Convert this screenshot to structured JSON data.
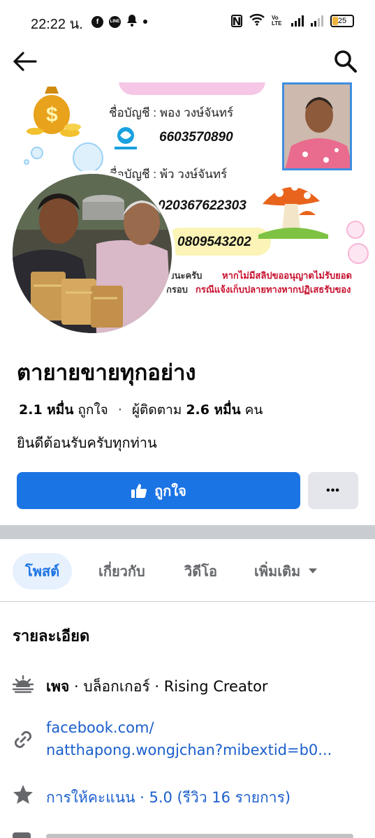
{
  "status_bar": {
    "time": "22:22 น.",
    "battery": "25",
    "volte": "Vo LTE"
  },
  "app_bar": {
    "back_icon": "arrow-left-icon",
    "search_icon": "search-icon"
  },
  "cover": {
    "account1_label": "ชื่อบัญชี : พอง  วงษ์จันทร์",
    "account1_number": "6603570890",
    "account2_label": "ชื่อบัญชี : พ้ว  วงษ์จันทร์",
    "account2_number": "020367622303",
    "phone": "0809543202",
    "note_left1": "ยนะครับ",
    "note_red1": "หากไม่มีสลิปขออนุญาตไม่รับยอด",
    "note_left2": "กรอบ",
    "note_red2": "กรณีแจ้งเก็บปลายทางหากปฏิเสธรับของ"
  },
  "page": {
    "name": "ตายายขายทุกอย่าง",
    "likes_count": "2.1 หมื่น",
    "likes_label": "ถูกใจ",
    "followers_label": "ผู้ติดตาม",
    "followers_count": "2.6 หมื่น",
    "followers_unit": "คน",
    "tagline": "ยินดีต้อนรับครับทุกท่าน"
  },
  "actions": {
    "like_label": "ถูกใจ",
    "more_label": "•••"
  },
  "tabs": [
    {
      "label": "โพสต์",
      "active": true
    },
    {
      "label": "เกี่ยวกับ",
      "active": false
    },
    {
      "label": "วิดีโอ",
      "active": false
    },
    {
      "label": "เพิ่มเติม",
      "active": false
    }
  ],
  "details": {
    "title": "รายละเอียด",
    "category_bold": "เพจ",
    "category_rest": " · บล็อกเกอร์ · Rising Creator",
    "link_line1": "facebook.com/",
    "link_line2": "natthapong.wongjchan?mibextid=b0...",
    "rating": "การให้คะแนน · 5.0 (รีวิว 16 รายการ)"
  },
  "colors": {
    "accent": "#1b74e4",
    "secondary_button": "#e4e6eb",
    "divider": "#c9ccd1",
    "link": "#1b5fcc"
  }
}
